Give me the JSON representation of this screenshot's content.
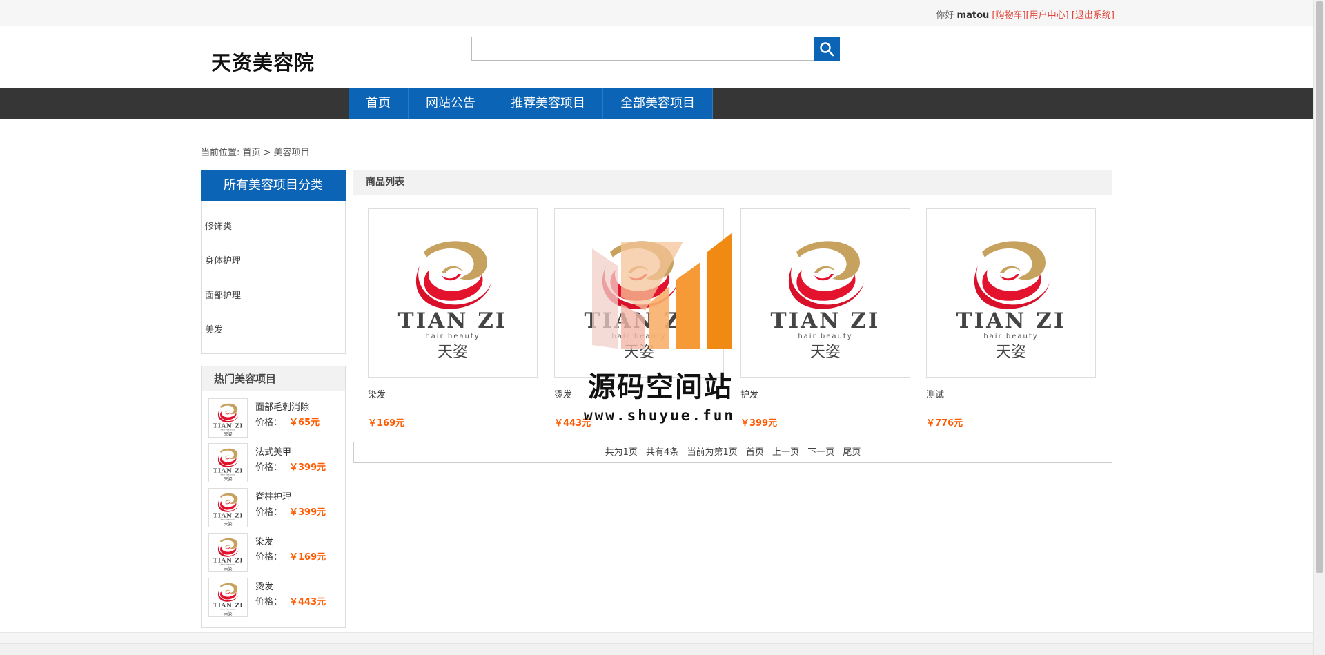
{
  "topbar": {
    "greeting": "你好",
    "username": "matou",
    "links": [
      "[购物车]",
      "[用户中心]",
      "[退出系统]"
    ]
  },
  "header": {
    "logo": "天资美容院",
    "search_placeholder": ""
  },
  "nav": {
    "items": [
      "首页",
      "网站公告",
      "推荐美容项目",
      "全部美容项目"
    ]
  },
  "breadcrumb": "当前位置: 首页 > 美容项目",
  "sidebar": {
    "title": "所有美容项目分类",
    "categories": [
      "修饰类",
      "身体护理",
      "面部护理",
      "美发"
    ]
  },
  "hot": {
    "title": "热门美容项目",
    "price_label": "价格：",
    "items": [
      {
        "name": "面部毛刺消除",
        "price": "￥65元"
      },
      {
        "name": "法式美甲",
        "price": "￥399元"
      },
      {
        "name": "脊柱护理",
        "price": "￥399元"
      },
      {
        "name": "染发",
        "price": "￥169元"
      },
      {
        "name": "烫发",
        "price": "￥443元"
      }
    ]
  },
  "list": {
    "title": "商品列表",
    "products": [
      {
        "name": "染发",
        "price": "￥169元"
      },
      {
        "name": "烫发",
        "price": "￥443元"
      },
      {
        "name": "护发",
        "price": "￥399元"
      },
      {
        "name": "测试",
        "price": "￥776元"
      }
    ]
  },
  "logo_img": {
    "brand": "TIAN ZI",
    "tagline": "hair beauty",
    "cn": "天姿"
  },
  "pager": {
    "parts": [
      "共为1页",
      "共有4条",
      "当前为第1页",
      "首页",
      "上一页",
      "下一页",
      "尾页"
    ]
  },
  "watermark": {
    "text": "源码空间站",
    "url": "www.shuyue.fun"
  },
  "colors": {
    "accent": "#0b64b5",
    "nav_bg": "#363636",
    "price": "#ff5a00",
    "link": "#e0443a"
  }
}
